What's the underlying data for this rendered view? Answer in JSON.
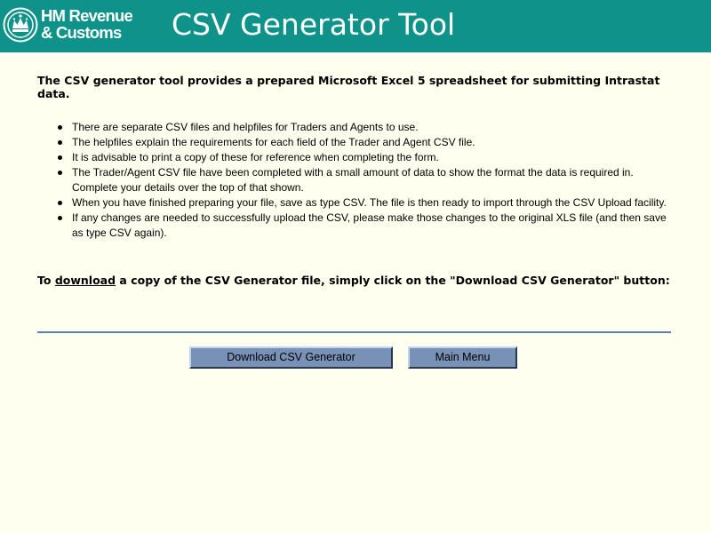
{
  "header": {
    "logo_line1": "HM Revenue",
    "logo_line2": "& Customs",
    "title": "CSV Generator Tool",
    "background_color": "#0e928a"
  },
  "intro": "The CSV generator tool provides a prepared Microsoft Excel 5 spreadsheet for submitting Intrastat data.",
  "bullets": [
    "There are separate CSV files and helpfiles for Traders and Agents to use.",
    "The helpfiles explain the requirements for each field of the Trader and Agent CSV file.",
    "It is advisable to print a copy of these for reference when completing the form.",
    "The Trader/Agent CSV file have been completed with a small amount of data to show the format the data is required in. Complete your details over the top of that shown.",
    "When you have finished preparing your file, save as type CSV. The file is then ready to import through the CSV Upload facility.",
    "If any changes are needed to successfully upload the CSV, please make those changes to the original XLS file (and then save as type CSV again)."
  ],
  "download_instruction": {
    "prefix": "To ",
    "link": "download",
    "suffix": " a copy of the CSV Generator file, simply click on the \"Download CSV Generator\" button:"
  },
  "buttons": {
    "download": "Download CSV Generator",
    "main_menu": "Main Menu"
  },
  "icons": {
    "logo": "hmrc-crown-crest-icon"
  }
}
